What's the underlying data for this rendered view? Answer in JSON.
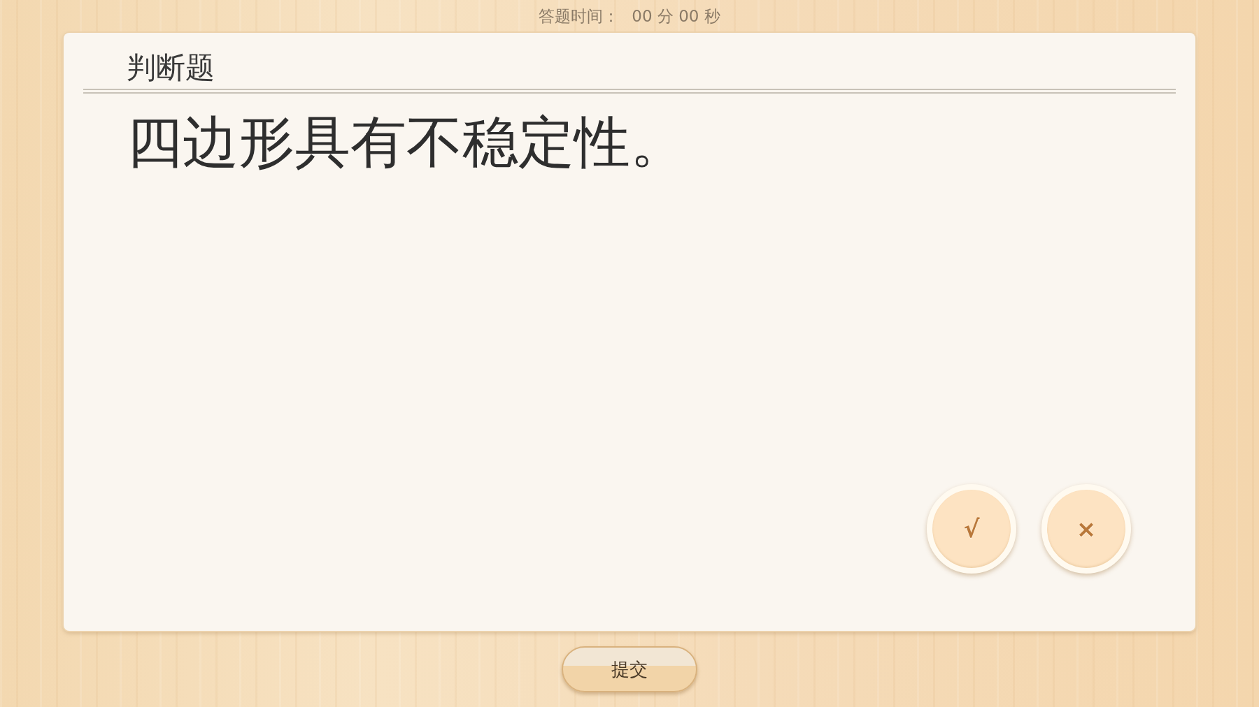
{
  "timer": {
    "label": "答题时间：",
    "value": "00 分 00 秒"
  },
  "question": {
    "type": "判断题",
    "text": "四边形具有不稳定性。"
  },
  "answers": [
    {
      "label": "√",
      "selected": false
    },
    {
      "label": "×",
      "selected": false
    }
  ],
  "submit": {
    "label": "提交"
  }
}
